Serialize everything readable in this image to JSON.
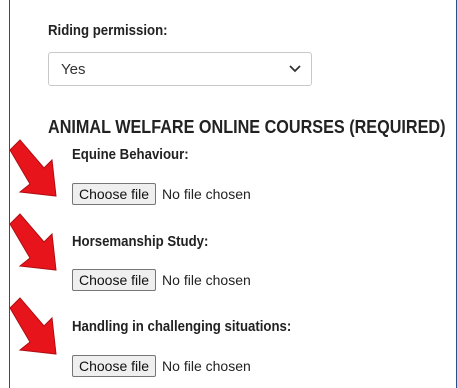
{
  "riding": {
    "label": "Riding permission:",
    "selected": "Yes"
  },
  "courses": {
    "heading": "ANIMAL WELFARE ONLINE COURSES (REQUIRED)",
    "items": [
      {
        "label": "Equine Behaviour:",
        "button": "Choose file",
        "status": "No file chosen"
      },
      {
        "label": "Horsemanship Study:",
        "button": "Choose file",
        "status": "No file chosen"
      },
      {
        "label": "Handling in challenging situations:",
        "button": "Choose file",
        "status": "No file chosen"
      }
    ]
  },
  "colors": {
    "arrow": "#e8141b",
    "arrow_outline": "#b00d12",
    "frame": "#2e4f86"
  }
}
